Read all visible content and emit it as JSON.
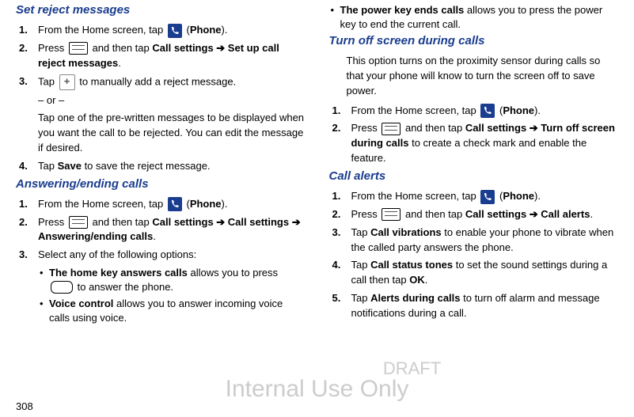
{
  "page_number": "308",
  "watermark_draft": "DRAFT",
  "watermark_internal": "Internal Use Only",
  "left": {
    "h1": "Set reject messages",
    "s1_a": "From the Home screen, tap ",
    "s1_b": " (",
    "s1_c": "Phone",
    "s1_d": ").",
    "s2_a": "Press ",
    "s2_b": " and then tap ",
    "s2_c": "Call settings ➔ Set up call reject messages",
    "s2_d": ".",
    "s3_a": "Tap ",
    "s3_b": " to manually add a reject message.",
    "s3_or": "– or –",
    "s3_desc": "Tap one of the pre-written messages to be displayed when you want the call to be rejected. You can edit the message if desired.",
    "s4_a": "Tap ",
    "s4_b": "Save",
    "s4_c": " to save the reject message.",
    "h2": "Answering/ending calls",
    "t1_a": "From the Home screen, tap ",
    "t1_b": " (",
    "t1_c": "Phone",
    "t1_d": ").",
    "t2_a": "Press ",
    "t2_b": " and then tap ",
    "t2_c": "Call settings ➔ Call settings ➔ Answering/ending calls",
    "t2_d": ".",
    "t3": "Select any of the following options:",
    "b1_a": "The home key answers calls",
    "b1_b": " allows you to press ",
    "b1_c": " to answer the phone.",
    "b2_a": "Voice control",
    "b2_b": " allows you to answer incoming voice calls using voice."
  },
  "right": {
    "b3_a": "The power key ends calls",
    "b3_b": " allows you to press the power key to end the current call.",
    "h3": "Turn off screen during calls",
    "intro3": "This option turns on the proximity sensor during calls so that your phone will know to turn the screen off to save power.",
    "u1_a": "From the Home screen, tap ",
    "u1_b": " (",
    "u1_c": "Phone",
    "u1_d": ").",
    "u2_a": "Press ",
    "u2_b": " and then tap ",
    "u2_c": "Call settings ➔ Turn off screen during calls",
    "u2_d": " to create a check mark and enable the feature.",
    "h4": "Call alerts",
    "v1_a": "From the Home screen, tap ",
    "v1_b": " (",
    "v1_c": "Phone",
    "v1_d": ").",
    "v2_a": "Press ",
    "v2_b": " and then tap ",
    "v2_c": "Call settings ➔ Call alerts",
    "v2_d": ".",
    "v3_a": "Tap ",
    "v3_b": "Call vibrations",
    "v3_c": " to enable your phone to vibrate when the called party answers the phone.",
    "v4_a": "Tap ",
    "v4_b": "Call status tones",
    "v4_c": " to set the sound settings during a call then tap ",
    "v4_d": "OK",
    "v4_e": ".",
    "v5_a": "Tap ",
    "v5_b": "Alerts during calls",
    "v5_c": " to turn off alarm and message notifications during a call."
  }
}
